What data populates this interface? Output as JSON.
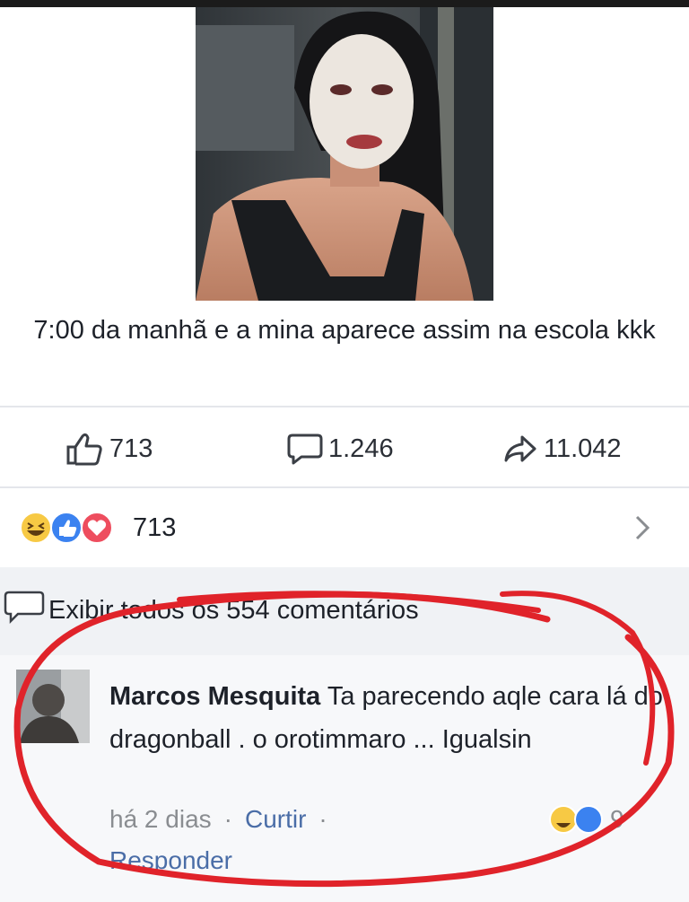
{
  "post": {
    "caption": "7:00 da manhã e a mina aparece assim na escola kkk",
    "image_description_icon": "photo-post-image"
  },
  "stats": {
    "likes": "713",
    "comments": "1.246",
    "shares": "11.042"
  },
  "reactions": {
    "count": "713",
    "icons": [
      "haha-icon",
      "like-icon",
      "love-icon"
    ]
  },
  "comments": {
    "view_all_label": "Exibir todos os 554 comentários",
    "items": [
      {
        "author": "Marcos Mesquita",
        "text": "Ta parecendo aqle cara lá do dragonball . o orotimmaro ... Igualsin",
        "time": "há 2 dias",
        "like_label": "Curtir",
        "reply_label": "Responder",
        "reaction_count": "9"
      }
    ]
  },
  "colors": {
    "annotation_red": "#e0232a",
    "link_blue": "#4a6da7",
    "comments_bg": "#f0f2f5"
  }
}
